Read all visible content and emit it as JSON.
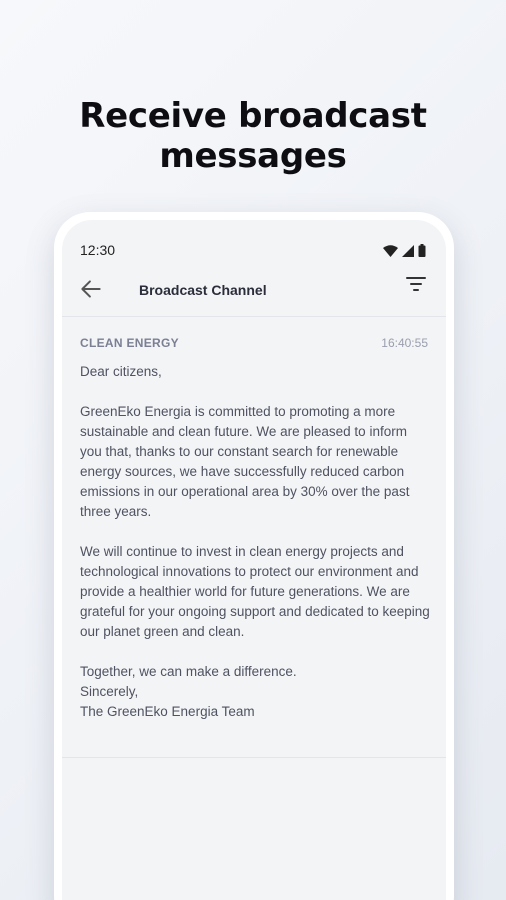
{
  "headline": [
    "Receive broadcast",
    "messages"
  ],
  "status_bar": {
    "time": "12:30",
    "icons": [
      "wifi-icon",
      "signal-icon",
      "battery-icon"
    ]
  },
  "app_bar": {
    "title": "Broadcast Channel",
    "back_icon": "arrow-left-icon",
    "filter_icon": "filter-icon"
  },
  "message": {
    "sender": "CLEAN ENERGY",
    "time": "16:40:55",
    "greeting": "Dear citizens,",
    "paragraph_1": "GreenEko Energia is committed to promoting a more sustainable and clean future. We are pleased to inform you that, thanks to our constant search for renewable energy sources, we have successfully reduced carbon emissions in our operational area by 30% over the past three years.",
    "paragraph_2": "We will continue to invest in clean energy projects and technological innovations to protect our environment and provide a healthier world for future generations. We are grateful for your ongoing support and dedicated to keeping our planet green and clean.",
    "closing_1": "Together, we can make a difference.",
    "closing_2": "Sincerely,",
    "closing_3": "The GreenEko Energia Team"
  },
  "colors": {
    "title": "#0e0e12",
    "sender": "#7a7f93",
    "body_text": "#4f5261",
    "screen_bg": "#f3f4f6"
  }
}
